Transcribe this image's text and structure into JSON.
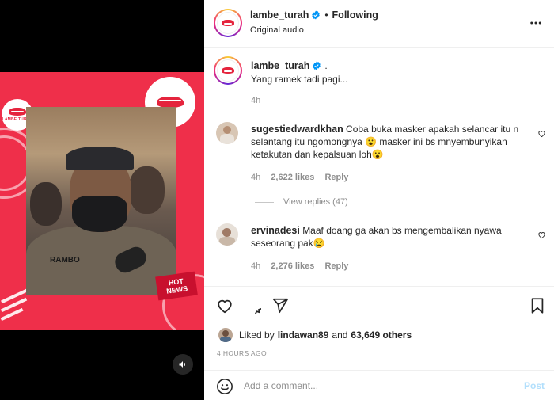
{
  "post": {
    "author": "lambe_turah",
    "follow_label": "Following",
    "separator": "•",
    "audio": "Original audio",
    "more_icon": "more-horizontal-icon",
    "verified_icon": "verified-badge-icon"
  },
  "media": {
    "nameplate": "RAMBO",
    "hot_news_line1": "HOT",
    "hot_news_line2": "NEWS",
    "logo_text": "LAMBE TURAH",
    "mute_icon": "speaker-icon"
  },
  "caption": {
    "username": "lambe_turah",
    "suffix": ".",
    "text": "Yang ramek tadi pagi...",
    "time": "4h"
  },
  "comments": [
    {
      "username": "sugestiedwardkhan",
      "text": "Coba buka masker apakah selancar itu n selantang itu ngomongnya 😮 masker ini bs mnyembunyikan ketakutan dan kepalsuan loh😮",
      "time": "4h",
      "likes": "2,622 likes",
      "reply": "Reply",
      "view_replies": "View replies (47)"
    },
    {
      "username": "ervinadesi",
      "text": "Maaf doang ga akan bs mengembalikan nyawa seseorang pak😢",
      "time": "4h",
      "likes": "2,276 likes",
      "reply": "Reply"
    }
  ],
  "actions": {
    "like_icon": "heart-icon",
    "comment_icon": "comment-icon",
    "share_icon": "send-icon",
    "save_icon": "bookmark-icon"
  },
  "likes": {
    "prefix": "Liked by",
    "user": "lindawan89",
    "and": "and",
    "others": "63,649 others"
  },
  "timestamp": "4 HOURS AGO",
  "composer": {
    "placeholder": "Add a comment...",
    "post_label": "Post",
    "emoji_icon": "emoji-icon"
  },
  "colors": {
    "accent_red": "#ef2f4a",
    "link_blue": "#0095f6",
    "post_disabled": "#b2dffc",
    "muted": "#8e8e8e"
  }
}
